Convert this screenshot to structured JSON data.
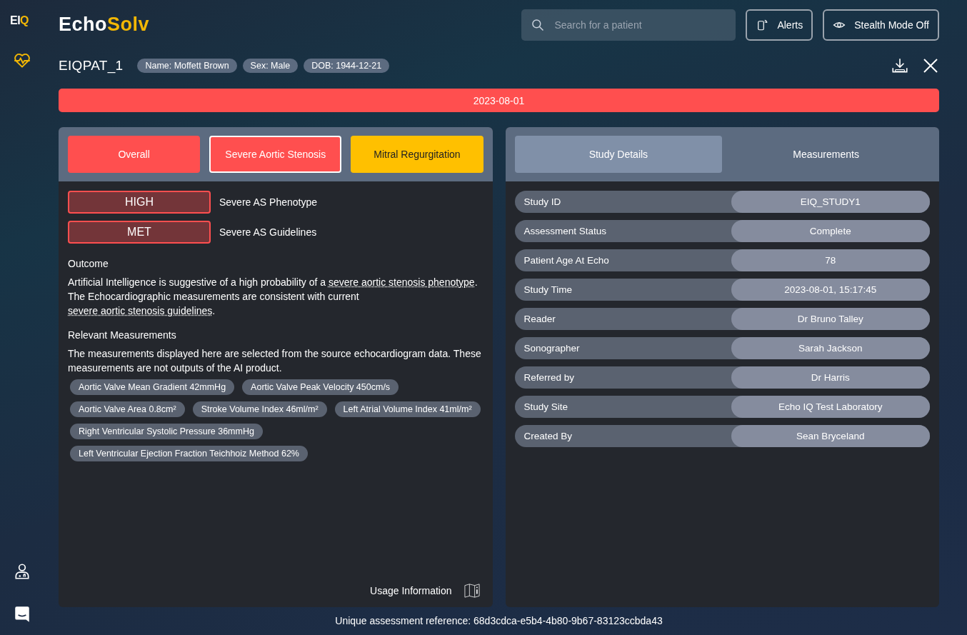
{
  "sidebar": {
    "logo": {
      "first": "EI",
      "second": "Q"
    },
    "items": [
      {
        "kind": "heart",
        "selected": true
      },
      {
        "kind": "clinician",
        "selected": false
      },
      {
        "kind": "chat",
        "selected": false
      }
    ]
  },
  "header": {
    "brand": {
      "first": "Echo",
      "second": "Solv"
    },
    "search": {
      "placeholder": "Search for a patient"
    },
    "buttons": [
      {
        "kind": "alerts",
        "label": "Alerts"
      },
      {
        "kind": "stealth",
        "label": "Stealth Mode Off"
      }
    ]
  },
  "patient": {
    "id": "EIQPAT_1",
    "tags": [
      "Name: Moffett Brown",
      "Sex: Male",
      "DOB: 1944-12-21"
    ]
  },
  "date_bar": "2023-08-01",
  "left_panel": {
    "tabs": [
      {
        "label": "Overall",
        "color": "#ff4f4f",
        "selected": false
      },
      {
        "label": "Severe Aortic Stenosis",
        "color": "#ff4f4f",
        "selected": true
      },
      {
        "label": "Mitral Regurgitation",
        "color": "#ffc000",
        "selected": false
      }
    ],
    "findings": [
      {
        "badge": "HIGH",
        "label": "Severe AS Phenotype"
      },
      {
        "badge": "MET",
        "label": "Severe AS Guidelines"
      }
    ],
    "outcome_title": "Outcome",
    "outcome": [
      {
        "text": "Artificial Intelligence is suggestive of a high probability of a ",
        "link": false
      },
      {
        "text": "severe aortic stenosis phenotype",
        "link": true
      },
      {
        "text": ". The Echocardiographic measurements are consistent with current ",
        "link": false
      },
      {
        "text": "severe aortic stenosis guidelines",
        "link": true
      },
      {
        "text": ".",
        "link": false
      }
    ],
    "measurements_title": "Relevant Measurements",
    "measurements_note": "The measurements displayed here are selected from the source echocardiogram data. These measurements are not outputs of the AI product.",
    "measurements": [
      "Aortic Valve Mean Gradient 42mmHg",
      "Aortic Valve Peak Velocity 450cm/s",
      "Aortic Valve Area 0.8cm²",
      "Stroke Volume Index 46ml/m²",
      "Left Atrial Volume Index 41ml/m²",
      "Right Ventricular Systolic Pressure 36mmHg",
      "Left Ventricular Ejection Fraction Teichhoiz Method 62%"
    ],
    "usage_link": "Usage Information"
  },
  "right_panel": {
    "tabs": [
      {
        "label": "Study Details",
        "selected": true
      },
      {
        "label": "Measurements",
        "selected": false
      }
    ],
    "rows": [
      {
        "label": "Study ID",
        "value": "EIQ_STUDY1"
      },
      {
        "label": "Assessment Status",
        "value": "Complete"
      },
      {
        "label": "Patient Age At Echo",
        "value": "78"
      },
      {
        "label": "Study Time",
        "value": "2023-08-01, 15:17:45"
      },
      {
        "label": "Reader",
        "value": "Dr Bruno Talley"
      },
      {
        "label": "Sonographer",
        "value": "Sarah Jackson"
      },
      {
        "label": "Referred by",
        "value": "Dr Harris"
      },
      {
        "label": "Study Site",
        "value": "Echo IQ Test Laboratory"
      },
      {
        "label": "Created By",
        "value": "Sean Bryceland"
      }
    ]
  },
  "footer": "Unique assessment reference: 68d3cdca-e5b4-4b80-9b67-83123ccbda43"
}
